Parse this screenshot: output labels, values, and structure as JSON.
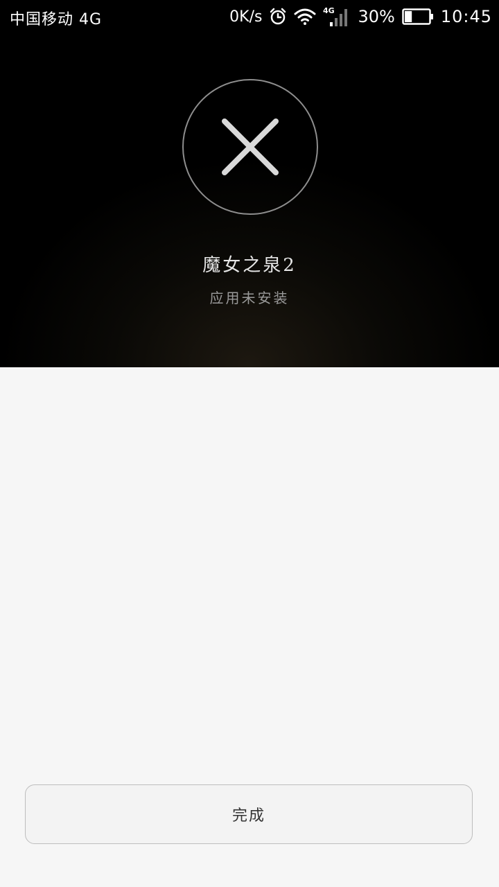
{
  "status_bar": {
    "carrier": "中国移动 4G",
    "net_speed": "0K/s",
    "signal_type": "4G",
    "battery_percent": "30%",
    "battery_level": 0.3,
    "time": "10:45",
    "icons": [
      "alarm-icon",
      "wifi-icon",
      "cell-signal-icon",
      "battery-icon"
    ]
  },
  "install_result": {
    "icon": "close-icon",
    "app_name": "魔女之泉2",
    "status": "应用未安装"
  },
  "actions": {
    "done_label": "完成"
  },
  "colors": {
    "hero_bg": "#000000",
    "content_bg": "#f6f6f6",
    "cross": "#d9d9d9",
    "circle_border": "#8e8e8e"
  }
}
